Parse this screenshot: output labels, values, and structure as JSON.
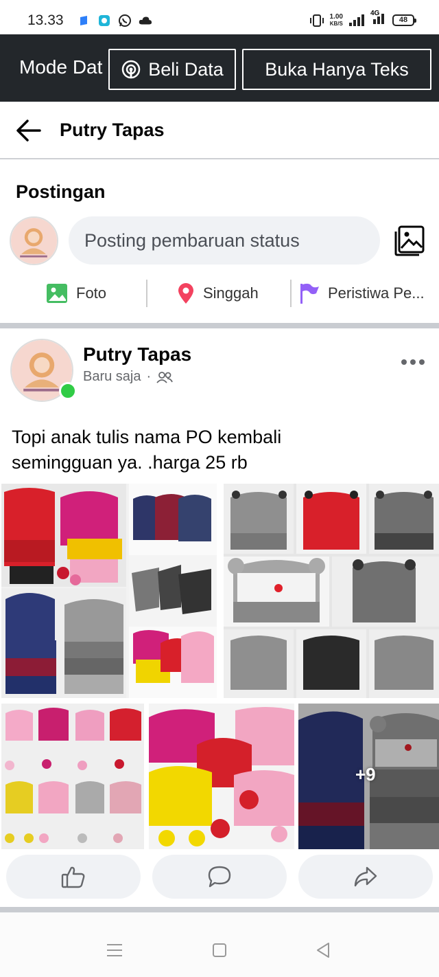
{
  "status_bar": {
    "time": "13.33",
    "net_speed_value": "1.00",
    "net_speed_unit": "KB/S",
    "network": "4G",
    "battery": "48"
  },
  "data_banner": {
    "mode_label": "Mode Dat",
    "buy_data_label": "Beli Data",
    "text_only_label": "Buka Hanya Teks"
  },
  "header": {
    "title": "Putry Tapas"
  },
  "composer": {
    "section_title": "Postingan",
    "input_placeholder": "Posting pembaruan status",
    "actions": [
      {
        "label": "Foto",
        "icon": "photo-icon"
      },
      {
        "label": "Singgah",
        "icon": "location-pin-icon"
      },
      {
        "label": "Peristiwa Pe...",
        "icon": "flag-icon"
      }
    ]
  },
  "post": {
    "author": "Putry Tapas",
    "time": "Baru saja",
    "separator": "·",
    "audience_icon": "friends-icon",
    "text_line1": "Topi anak tulis nama PO kembali",
    "text_line2": "semingguan ya. .harga 25 rb",
    "extra_photos": "+9"
  },
  "colors": {
    "banner_bg": "#23272b",
    "online": "#31cc46",
    "input_bg": "#f0f2f5",
    "secondary_text": "#65676b",
    "foto_icon": "#45bd62",
    "pin_icon": "#f3425f",
    "flag_icon": "#9360f7"
  }
}
